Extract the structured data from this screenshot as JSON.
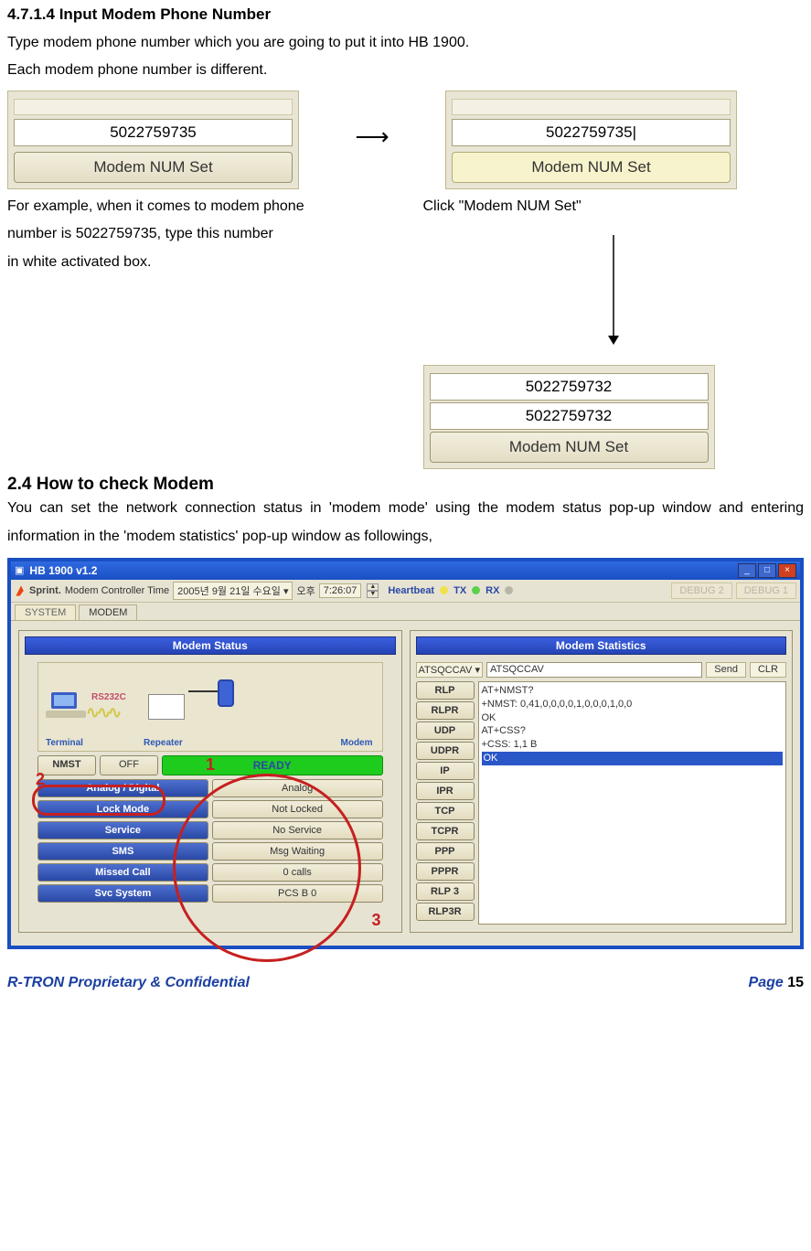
{
  "section1": {
    "heading": "4.7.1.4 Input Modem Phone Number",
    "para1": "Type modem phone number which you are going to put it into HB 1900.",
    "para2": "Each modem phone number is different."
  },
  "panelA": {
    "number": "5022759735",
    "button": "Modem NUM Set"
  },
  "panelB": {
    "number": "5022759735",
    "button": "Modem NUM Set",
    "caret": "|"
  },
  "captionL1": "For example, when it comes to modem phone",
  "captionL2": "number is 5022759735, type this number",
  "captionL3": "in white activated box.",
  "captionR": "Click \"Modem NUM Set\"",
  "panelC": {
    "top": "5022759732",
    "mid": "5022759732",
    "button": "Modem NUM Set"
  },
  "section2": {
    "heading": "2.4 How to check Modem",
    "para": "You can set the network connection status in 'modem mode' using the modem status pop-up window and entering information in the 'modem statistics' pop-up window as followings,"
  },
  "app": {
    "title": "HB 1900 v1.2",
    "sprint": "Sprint.",
    "controllerLabel": "Modem Controller Time",
    "date": "2005년  9월 21일 수요일",
    "ampm": "오후",
    "time": "7:26:07",
    "heartbeat": "Heartbeat",
    "tx": "TX",
    "rx": "RX",
    "debug2": "DEBUG 2",
    "debug1": "DEBUG 1",
    "tabs": {
      "system": "SYSTEM",
      "modem": "MODEM"
    },
    "status": {
      "header": "Modem Status",
      "rs": "RS232C",
      "l1": "Terminal",
      "l2": "Repeater",
      "l3": "Modem",
      "nmst": "NMST",
      "off": "OFF",
      "ready": "READY",
      "rows": [
        {
          "l": "Analog / Digital",
          "r": "Analog"
        },
        {
          "l": "Lock  Mode",
          "r": "Not Locked"
        },
        {
          "l": "Service",
          "r": "No Service"
        },
        {
          "l": "SMS",
          "r": "Msg Waiting"
        },
        {
          "l": "Missed Call",
          "r": "0 calls"
        },
        {
          "l": "Svc System",
          "r": "PCS B 0"
        }
      ],
      "red1": "1",
      "red2": "2",
      "red3": "3"
    },
    "stat": {
      "header": "Modem Statistics",
      "selectVal": "ATSQCCAV",
      "cmd": "ATSQCCAV",
      "send": "Send",
      "clr": "CLR",
      "buttons": [
        "RLP",
        "RLPR",
        "UDP",
        "UDPR",
        "IP",
        "IPR",
        "TCP",
        "TCPR",
        "PPP",
        "PPPR",
        "RLP 3",
        "RLP3R"
      ],
      "console": {
        "l1": "AT+NMST?",
        "l2": "+NMST: 0,41,0,0,0,0,1,0,0,0,1,0,0",
        "l3": "OK",
        "l4": "AT+CSS?",
        "l5": "+CSS: 1,1 B",
        "sel": "OK"
      }
    }
  },
  "footer": {
    "left": "R-TRON Proprietary & Confidential",
    "rightLabel": "Page ",
    "pageNo": "15"
  }
}
